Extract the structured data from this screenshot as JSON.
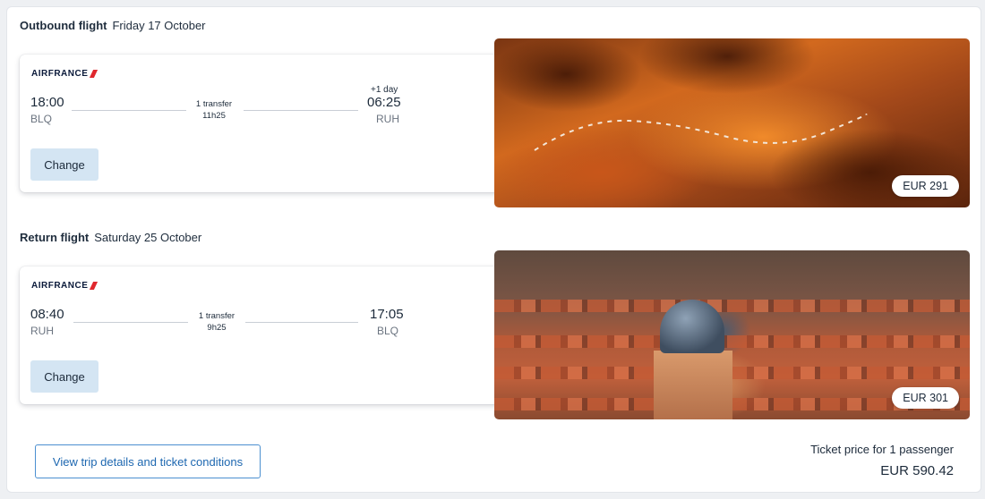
{
  "outbound": {
    "heading": "Outbound flight",
    "date": "Friday 17 October",
    "airline": "AIRFRANCE",
    "departure_time": "18:00",
    "departure_code": "BLQ",
    "arrival_time": "06:25",
    "arrival_code": "RUH",
    "day_offset": "+1 day",
    "transfers": "1 transfer",
    "duration": "11h25",
    "change_label": "Change",
    "price": "EUR 291"
  },
  "return": {
    "heading": "Return flight",
    "date": "Saturday 25 October",
    "airline": "AIRFRANCE",
    "departure_time": "08:40",
    "departure_code": "RUH",
    "arrival_time": "17:05",
    "arrival_code": "BLQ",
    "transfers": "1 transfer",
    "duration": "9h25",
    "change_label": "Change",
    "price": "EUR 301"
  },
  "footer": {
    "details_label": "View trip details and ticket conditions",
    "ticket_price_label": "Ticket price for 1 passenger",
    "ticket_total": "EUR 590.42"
  },
  "colors": {
    "airline_red": "#e0282e",
    "button_bg": "#d4e5f3",
    "link_blue": "#1d67b0"
  }
}
